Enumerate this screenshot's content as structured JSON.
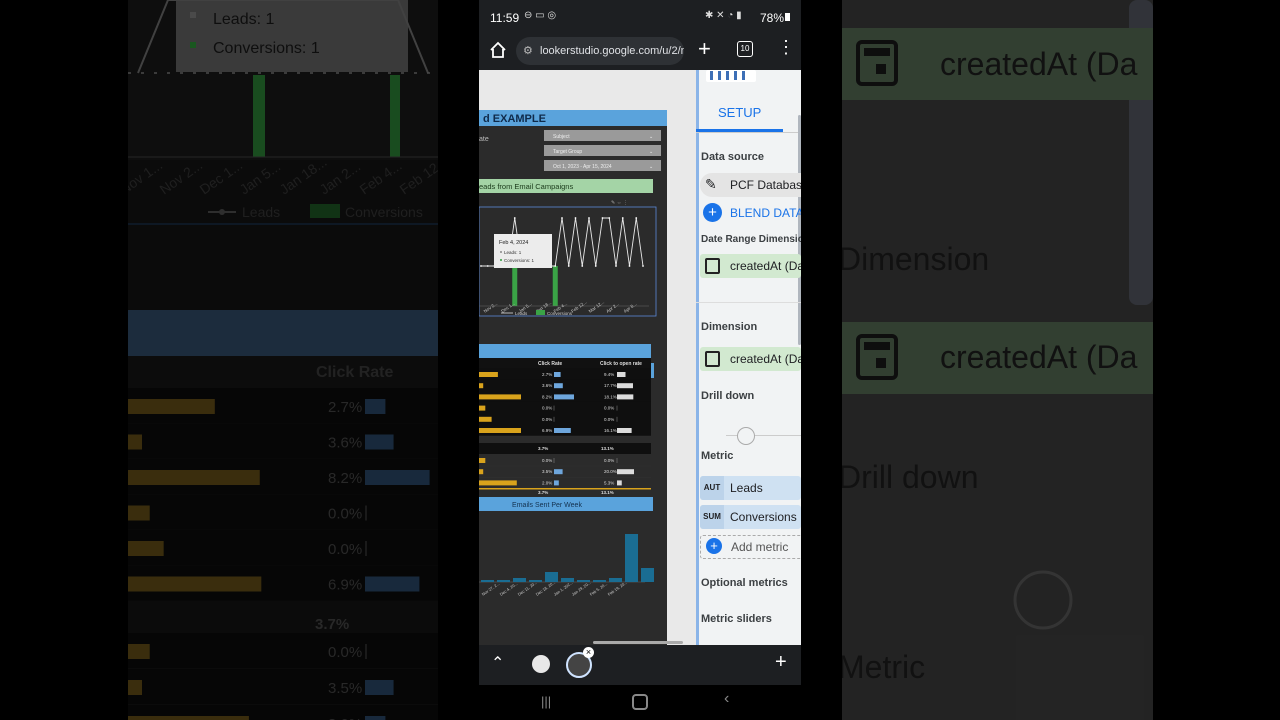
{
  "status": {
    "time": "11:59",
    "battery": "78%"
  },
  "browser": {
    "url": "lookerstudio.google.com/u/2/r",
    "tab_count": "10"
  },
  "report": {
    "title": "d EXAMPLE",
    "filter_label": "ate",
    "filters": [
      {
        "label": "Subject"
      },
      {
        "label": "Target Group"
      },
      {
        "label": "Oct 1, 2023 - Apr 15, 2024"
      }
    ],
    "section_leads": "eads from Email Campaigns",
    "tooltip": {
      "date": "Feb 4, 2024",
      "leads": "Leads: 1",
      "conversions": "Conversions: 1"
    },
    "legend": {
      "leads": "Leads",
      "conversions": "Conversions"
    },
    "x_ticks": [
      "Nov 2...",
      "Dec 1...",
      "Jan 5...",
      "Jan 18...",
      "Feb 4...",
      "Feb 12...",
      "Mar 12...",
      "Apr 2...",
      "Apr 8..."
    ],
    "table": {
      "headers": [
        "Click Rate",
        "Click to open rate"
      ],
      "rows": [
        {
          "bar": 0.45,
          "click": "2.7%",
          "clickbar": 0.33,
          "open": "9.4%",
          "openbar": 0.5
        },
        {
          "bar": 0.1,
          "click": "3.6%",
          "clickbar": 0.44,
          "open": "17.7%",
          "openbar": 0.94
        },
        {
          "bar": 1.0,
          "click": "8.2%",
          "clickbar": 1.0,
          "open": "18.1%",
          "openbar": 0.96
        },
        {
          "bar": 0.15,
          "click": "0.0%",
          "clickbar": 0,
          "open": "0.0%",
          "openbar": 0
        },
        {
          "bar": 0.3,
          "click": "0.0%",
          "clickbar": 0,
          "open": "0.0%",
          "openbar": 0
        },
        {
          "bar": 1.0,
          "click": "6.9%",
          "clickbar": 0.84,
          "open": "16.1%",
          "openbar": 0.86
        }
      ],
      "total_click": "3.7%",
      "total_open": "13.1%",
      "rows2": [
        {
          "bar": 0.15,
          "click": "0.0%",
          "clickbar": 0,
          "open": "0.0%",
          "openbar": 0
        },
        {
          "bar": 0.1,
          "click": "3.5%",
          "clickbar": 0.43,
          "open": "20.0%",
          "openbar": 1.0
        },
        {
          "bar": 0.9,
          "click": "2.0%",
          "clickbar": 0.24,
          "open": "5.3%",
          "openbar": 0.28
        }
      ],
      "total2_click": "3.7%",
      "total2_open": "13.1%"
    },
    "emails_title": "Emails Sent Per Week",
    "email_ticks": [
      "Nov 27, 2...",
      "Dec 4, 20...",
      "Dec 11, 20...",
      "Dec 18, 20...",
      "Jan 1, 202...",
      "Jan 29, 20...",
      "Feb 5, 20...",
      "Feb 19, 20..."
    ]
  },
  "setup": {
    "tab": "SETUP",
    "data_source_label": "Data source",
    "data_source": "PCF Databas",
    "blend": "BLEND DATA",
    "date_range_label": "Date Range Dimensio",
    "date_range_value": "createdAt (Da",
    "dimension_label": "Dimension",
    "dimension_value": "createdAt (Da",
    "drill_label": "Drill down",
    "metric_label": "Metric",
    "metrics": [
      {
        "agg": "AUT",
        "name": "Leads"
      },
      {
        "agg": "SUM",
        "name": "Conversions"
      }
    ],
    "add_metric": "Add metric",
    "optional_label": "Optional metrics",
    "sliders_label": "Metric sliders"
  },
  "bg_left": {
    "legend_leads": "Leads",
    "legend_conv": "Conversions",
    "tip_leads": "Leads: 1",
    "tip_conv": "Conversions: 1",
    "col_header": "Click Rate",
    "rows": [
      {
        "bar": 0.56,
        "val": "2.7%",
        "cb": 0.3
      },
      {
        "bar": 0.09,
        "val": "3.6%",
        "cb": 0.42
      },
      {
        "bar": 0.85,
        "val": "8.2%",
        "cb": 0.95
      },
      {
        "bar": 0.14,
        "val": "0.0%",
        "cb": 0
      },
      {
        "bar": 0.23,
        "val": "0.0%",
        "cb": 0
      },
      {
        "bar": 0.86,
        "val": "6.9%",
        "cb": 0.8
      }
    ],
    "total": "3.7%",
    "rows2": [
      {
        "bar": 0.14,
        "val": "0.0%",
        "cb": 0
      },
      {
        "bar": 0.07,
        "val": "3.5%",
        "cb": 0.42
      },
      {
        "bar": 0.78,
        "val": "3.0%",
        "cb": 0.3
      }
    ],
    "ticks": [
      "Nov 1...",
      "Nov 2...",
      "Dec 1...",
      "Jan 5...",
      "Jan 18...",
      "Jan 2...",
      "Feb 4...",
      "Feb 12..."
    ]
  },
  "bg_right": {
    "chip1": "createdAt (Da",
    "dim": "Dimension",
    "chip2": "createdAt (Da",
    "drill": "Drill down",
    "metric": "Metric"
  },
  "chart_data": [
    {
      "type": "line",
      "title": "eads from Email Campaigns",
      "series": [
        {
          "name": "Leads",
          "values": [
            0,
            0,
            0,
            0,
            0,
            1,
            0,
            0,
            0,
            0,
            0,
            0,
            1,
            0,
            1,
            0,
            1,
            0,
            1,
            1,
            0,
            1,
            0,
            1,
            0
          ]
        },
        {
          "name": "Conversions",
          "values": [
            0,
            0,
            0,
            0,
            0,
            1,
            0,
            0,
            0,
            0,
            0,
            1,
            0,
            0,
            0,
            0,
            0,
            0,
            0,
            0,
            0,
            0,
            0,
            0,
            0
          ]
        }
      ],
      "ylim": [
        0,
        1
      ]
    },
    {
      "type": "bar",
      "title": "Emails Sent Per Week",
      "values": [
        1,
        1,
        2,
        1,
        5,
        2,
        1,
        1,
        2,
        24,
        7
      ],
      "ylim": [
        0,
        26
      ]
    }
  ]
}
